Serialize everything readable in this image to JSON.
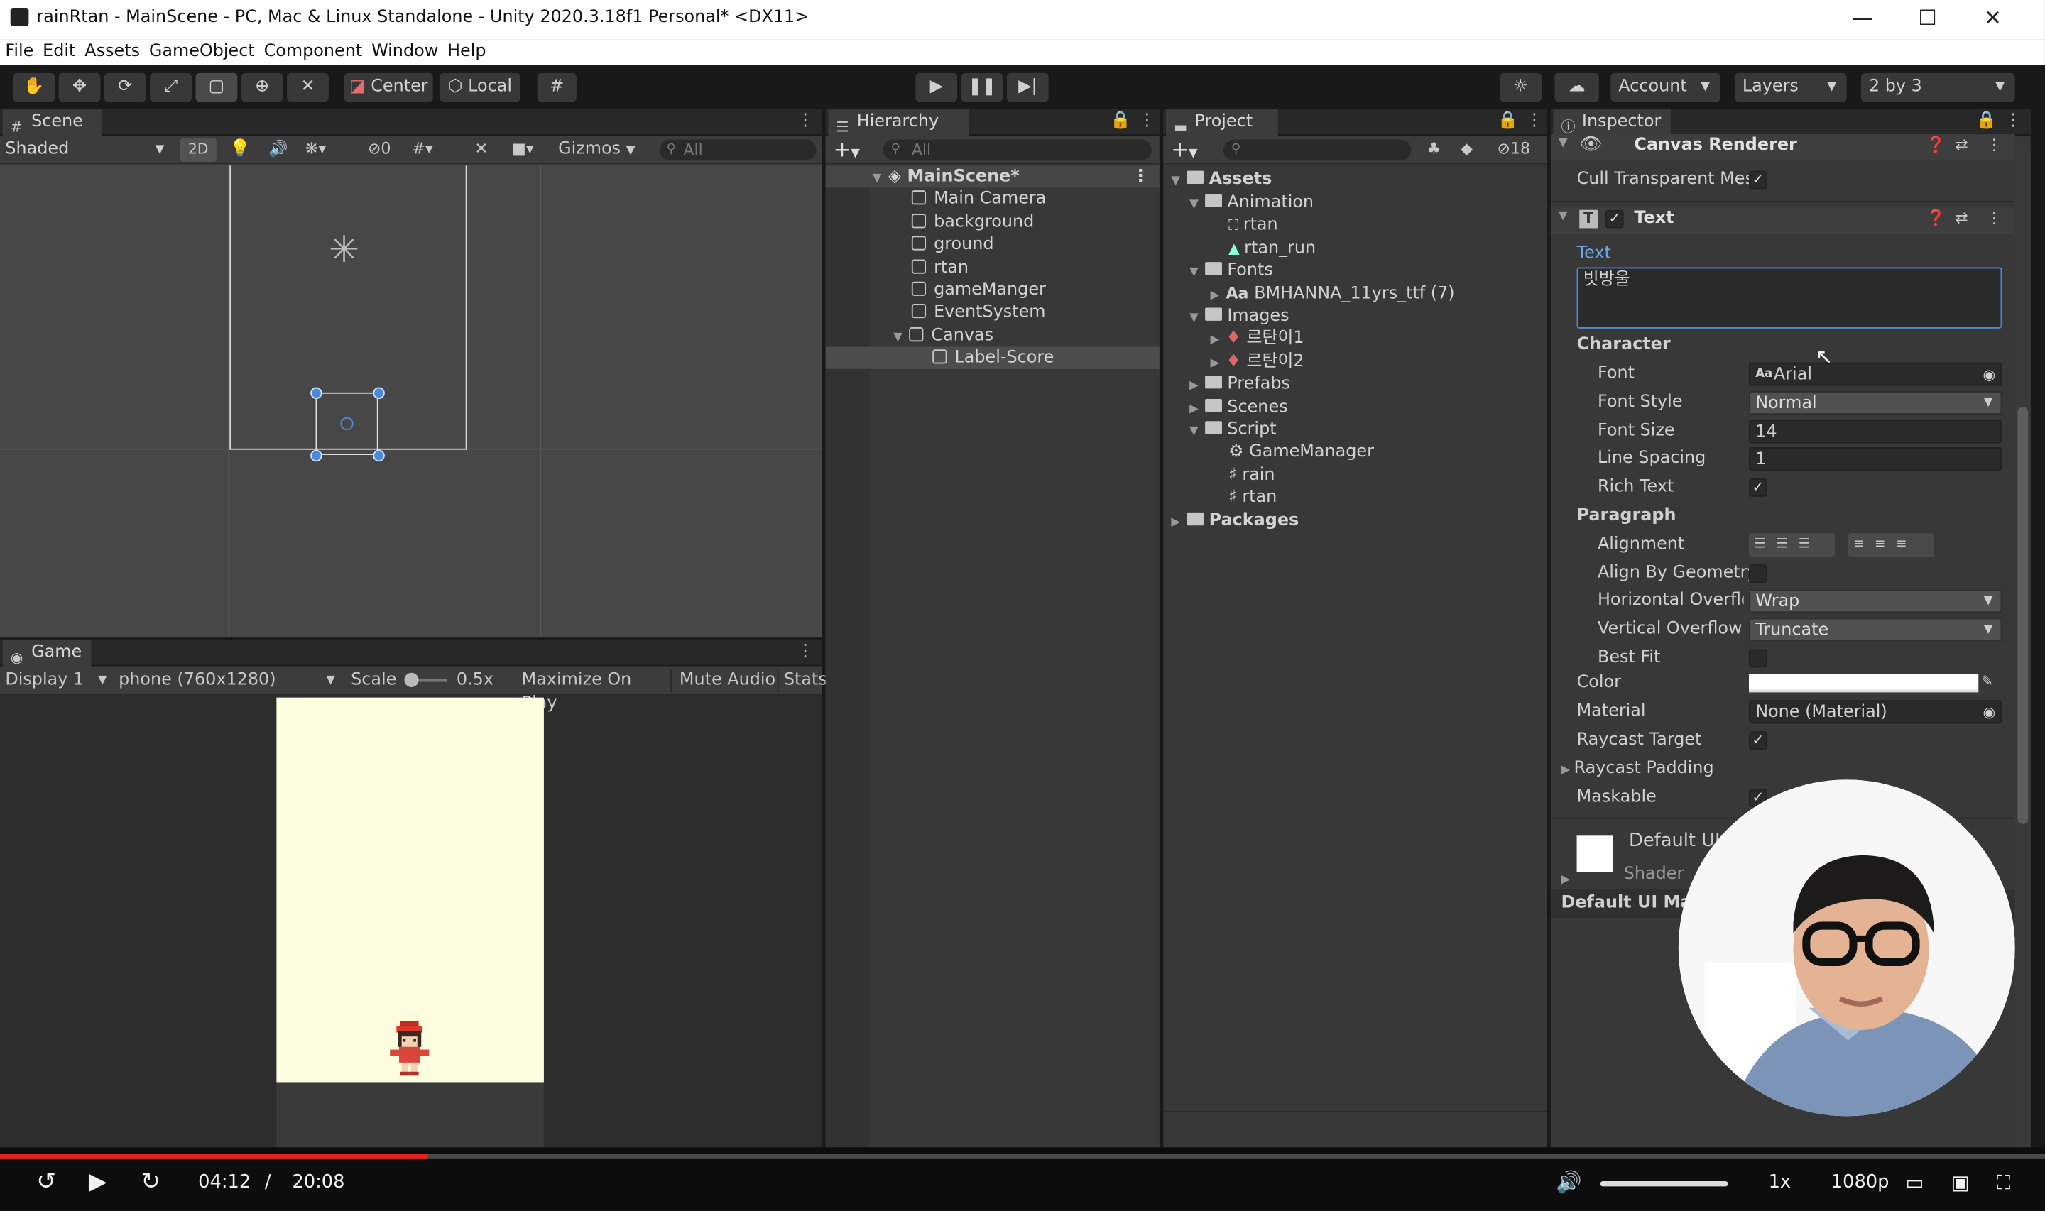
{
  "window": {
    "title": "rainRtan - MainScene - PC, Mac & Linux Standalone - Unity 2020.3.18f1 Personal* <DX11>",
    "minimize": "—",
    "maximize": "☐",
    "close": "✕"
  },
  "menu": [
    "File",
    "Edit",
    "Assets",
    "GameObject",
    "Component",
    "Window",
    "Help"
  ],
  "toolbar": {
    "pivot": "Center",
    "space": "Local",
    "account": "Account",
    "layers": "Layers",
    "layout": "2 by 3"
  },
  "scene": {
    "tab": "Scene",
    "shading": "Shaded",
    "mode2d": "2D",
    "hidden_count": "0",
    "gizmos": "Gizmos",
    "search_placeholder": "All"
  },
  "game": {
    "tab": "Game",
    "display": "Display 1",
    "resolution": "phone (760x1280)",
    "scale_label": "Scale",
    "scale_value": "0.5x",
    "maximize": "Maximize On Play",
    "mute": "Mute Audio",
    "stats": "Stats"
  },
  "hierarchy": {
    "tab": "Hierarchy",
    "search_placeholder": "All",
    "scene_name": "MainScene*",
    "items": [
      "Main Camera",
      "background",
      "ground",
      "rtan",
      "gameManger",
      "EventSystem",
      "Canvas"
    ],
    "child": "Label-Score"
  },
  "project": {
    "tab": "Project",
    "hidden_count": "18",
    "assets": "Assets",
    "animation": "Animation",
    "anim_items": [
      "rtan",
      "rtan_run"
    ],
    "fonts": "Fonts",
    "font_item": "BMHANNA_11yrs_ttf (7)",
    "images": "Images",
    "image_items": [
      "르탄이1",
      "르탄이2"
    ],
    "prefabs": "Prefabs",
    "scenes": "Scenes",
    "script": "Script",
    "script_items": [
      "GameManager",
      "rain",
      "rtan"
    ],
    "packages": "Packages"
  },
  "inspector": {
    "tab": "Inspector",
    "canvas_renderer": "Canvas Renderer",
    "cull_label": "Cull Transparent Mes",
    "text_component": "Text",
    "text_label": "Text",
    "text_value": "빗방울",
    "character": "Character",
    "font_label": "Font",
    "font_value": "Arial",
    "font_style_label": "Font Style",
    "font_style_value": "Normal",
    "font_size_label": "Font Size",
    "font_size_value": "14",
    "line_spacing_label": "Line Spacing",
    "line_spacing_value": "1",
    "rich_text_label": "Rich Text",
    "paragraph": "Paragraph",
    "alignment_label": "Alignment",
    "align_geom_label": "Align By Geometry",
    "h_overflow_label": "Horizontal Overflov",
    "h_overflow_value": "Wrap",
    "v_overflow_label": "Vertical Overflow",
    "v_overflow_value": "Truncate",
    "best_fit_label": "Best Fit",
    "color_label": "Color",
    "material_label": "Material",
    "material_value": "None (Material)",
    "raycast_label": "Raycast Target",
    "raycast_padding_label": "Raycast Padding",
    "maskable_label": "Maskable",
    "default_ui": "Default UI",
    "shader_label": "Shader",
    "default_ui_mat": "Default UI Mate"
  },
  "video": {
    "current": "04:12",
    "separator": "/",
    "total": "20:08",
    "speed": "1x",
    "quality": "1080p",
    "progress_fraction": 0.209
  },
  "colors": {
    "unity_panel": "#383838",
    "game_bg": "#fffde0",
    "selection": "#4d4d4d",
    "accent_blue": "#4b8ad6",
    "progress_red": "#e62117"
  }
}
